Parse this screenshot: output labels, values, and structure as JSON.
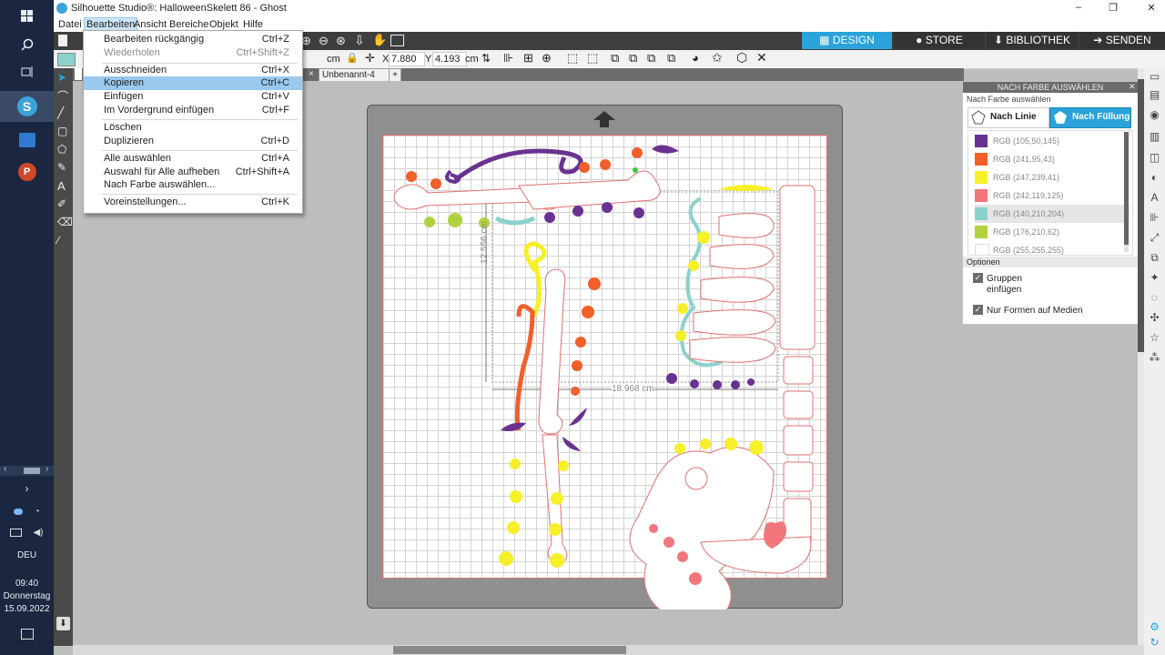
{
  "window": {
    "title": "Silhouette Studio®: HalloweenSkelett 86 - Ghost",
    "controls": [
      "–",
      "❐",
      "✕"
    ]
  },
  "menubar": [
    "Datei",
    "Bearbeiten",
    "Ansicht",
    "Bereiche",
    "Objekt",
    "Hilfe"
  ],
  "top_tabs": [
    {
      "label": "DESIGN",
      "color": "#29a3d9"
    },
    {
      "label": "STORE",
      "color": "#2e2e2e"
    },
    {
      "label": "BIBLIOTHEK",
      "color": "#2e2e2e"
    },
    {
      "label": "SENDEN",
      "color": "#2e2e2e"
    }
  ],
  "propbar": {
    "unit": "cm",
    "x_label": "X",
    "x_value": "7.880",
    "y_label": "Y",
    "y_value": "4.193",
    "unit2": "cm"
  },
  "doc_tabs": [
    "Unbenannt-4",
    "+"
  ],
  "dropdown": {
    "items": [
      {
        "label": "Bearbeiten rückgängig",
        "shortcut": "Ctrl+Z",
        "disabled": false
      },
      {
        "label": "Wiederholen",
        "shortcut": "Ctrl+Shift+Z",
        "disabled": true
      },
      {
        "label": "Ausschneiden",
        "shortcut": "Ctrl+X",
        "disabled": false
      },
      {
        "label": "Kopieren",
        "shortcut": "Ctrl+C",
        "disabled": false,
        "highlighted": true
      },
      {
        "label": "Einfügen",
        "shortcut": "Ctrl+V",
        "disabled": false
      },
      {
        "label": "Im Vordergrund einfügen",
        "shortcut": "Ctrl+F",
        "disabled": false
      },
      {
        "label": "Löschen",
        "shortcut": "",
        "disabled": false
      },
      {
        "label": "Duplizieren",
        "shortcut": "Ctrl+D",
        "disabled": false
      },
      {
        "label": "Alle auswählen",
        "shortcut": "Ctrl+A",
        "disabled": false
      },
      {
        "label": "Auswahl für Alle aufheben",
        "shortcut": "Ctrl+Shift+A",
        "disabled": false
      },
      {
        "label": "Nach Farbe auswählen...",
        "shortcut": "",
        "disabled": false
      },
      {
        "label": "Voreinstellungen...",
        "shortcut": "Ctrl+K",
        "disabled": false
      }
    ]
  },
  "canvas": {
    "height_dim": "12.556 cm",
    "width_dim": "18.968 cm"
  },
  "panel": {
    "header": "NACH FARBE AUSWÄHLEN",
    "subtitle": "Nach Farbe auswählen",
    "mode_line": "Nach Linie",
    "mode_fill": "Nach Füllung",
    "colors": [
      {
        "label": "RGB (105,50,145)",
        "hex": "#693291"
      },
      {
        "label": "RGB (241,95,43)",
        "hex": "#f15f2b"
      },
      {
        "label": "RGB (247,239,41)",
        "hex": "#f7ef29"
      },
      {
        "label": "RGB (242,119,125)",
        "hex": "#f2777d"
      },
      {
        "label": "RGB (140,210,204)",
        "hex": "#8cd2cc"
      },
      {
        "label": "RGB (176,210,62)",
        "hex": "#b0d23e"
      },
      {
        "label": "RGB (255,255,255)",
        "hex": "#ffffff"
      }
    ],
    "options_label": "Optionen",
    "opt_group": "Gruppen einfügen",
    "opt_group_line1": "Gruppen",
    "opt_group_line2": "einfügen",
    "opt_media": "Nur Formen auf Medien"
  },
  "taskbar": {
    "lang": "DEU",
    "time": "09:40",
    "day": "Donnerstag",
    "date": "15.09.2022"
  },
  "colors": {
    "accent": "#29a3d9",
    "highlight": "#99c9ef",
    "mat": "#8f8f8f"
  }
}
